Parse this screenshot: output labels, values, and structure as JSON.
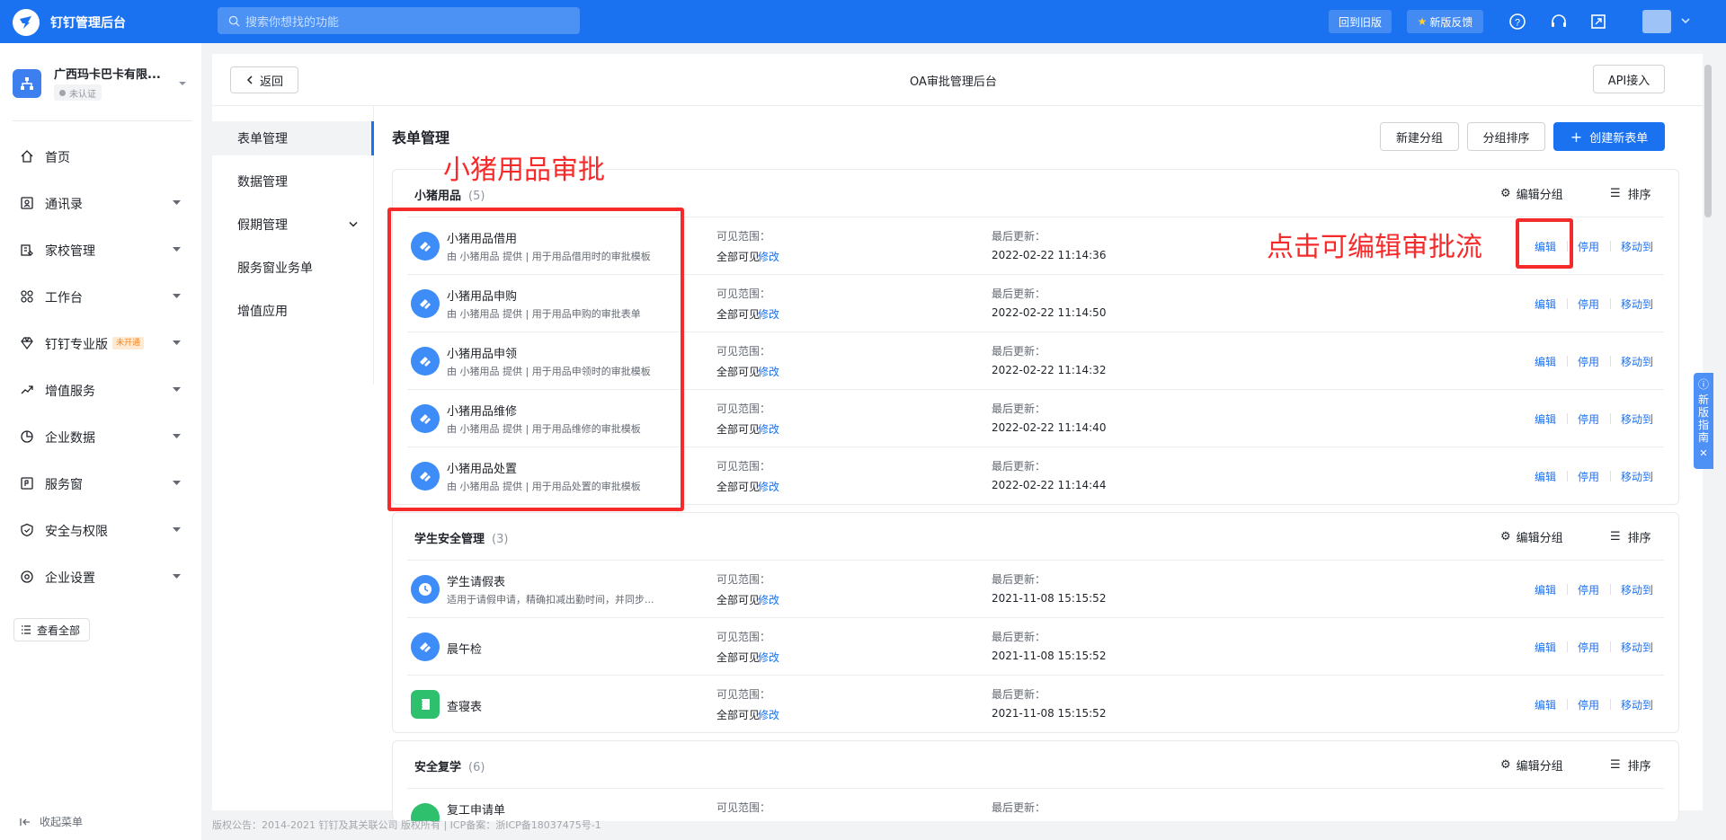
{
  "topbar": {
    "app_title": "钉钉管理后台",
    "search_placeholder": "搜索你想找的功能",
    "old_version_label": "回到旧版",
    "feedback_label": "新版反馈"
  },
  "sidebar": {
    "org_name": "广西玛卡巴卡有限...",
    "org_status": "未认证",
    "items": [
      {
        "label": "首页",
        "icon": "home-icon"
      },
      {
        "label": "通讯录",
        "icon": "contacts-icon"
      },
      {
        "label": "家校管理",
        "icon": "school-icon"
      },
      {
        "label": "工作台",
        "icon": "workbench-icon"
      },
      {
        "label": "钉钉专业版",
        "icon": "diamond-icon",
        "tag": "未开通"
      },
      {
        "label": "增值服务",
        "icon": "trend-icon"
      },
      {
        "label": "企业数据",
        "icon": "data-icon"
      },
      {
        "label": "服务窗",
        "icon": "service-window-icon"
      },
      {
        "label": "安全与权限",
        "icon": "shield-icon"
      },
      {
        "label": "企业设置",
        "icon": "settings-icon"
      }
    ],
    "view_all": "查看全部",
    "collapse": "收起菜单"
  },
  "main": {
    "back_label": "返回",
    "title": "OA审批管理后台",
    "api_label": "API接入",
    "subnav": [
      "表单管理",
      "数据管理",
      "假期管理",
      "服务窗业务单",
      "增值应用"
    ],
    "content_title": "表单管理",
    "new_group": "新建分组",
    "group_sort": "分组排序",
    "create_form": "创建新表单",
    "edit_group": "编辑分组",
    "sort": "排序",
    "visibility_label": "可见范围：",
    "visibility_value": "全部可见",
    "modify": "修改",
    "updated_label": "最后更新：",
    "actions": {
      "edit": "编辑",
      "disable": "停用",
      "move": "移动到"
    }
  },
  "groups": [
    {
      "name": "小猪用品",
      "count": "(5)",
      "rows": [
        {
          "name": "小猪用品借用",
          "desc": "由 小猪用品 提供 | 用于用品借用时的审批模板",
          "updated": "2022-02-22 11:14:36",
          "icon": "approval-icon",
          "color": "#3e8cf7"
        },
        {
          "name": "小猪用品申购",
          "desc": "由 小猪用品 提供 | 用于用品申购的审批表单",
          "updated": "2022-02-22 11:14:50",
          "icon": "approval-icon",
          "color": "#3e8cf7"
        },
        {
          "name": "小猪用品申领",
          "desc": "由 小猪用品 提供 | 用于用品申领时的审批模板",
          "updated": "2022-02-22 11:14:32",
          "icon": "approval-icon",
          "color": "#3e8cf7"
        },
        {
          "name": "小猪用品维修",
          "desc": "由 小猪用品 提供 | 用于用品维修的审批模板",
          "updated": "2022-02-22 11:14:40",
          "icon": "approval-icon",
          "color": "#3e8cf7"
        },
        {
          "name": "小猪用品处置",
          "desc": "由 小猪用品 提供 | 用于用品处置的审批模板",
          "updated": "2022-02-22 11:14:44",
          "icon": "approval-icon",
          "color": "#3e8cf7"
        }
      ]
    },
    {
      "name": "学生安全管理",
      "count": "(3)",
      "rows": [
        {
          "name": "学生请假表",
          "desc": "适用于请假申请，精确扣减出勤时间，并同步...",
          "updated": "2021-11-08 15:15:52",
          "icon": "clock-icon",
          "color": "#3e8cf7"
        },
        {
          "name": "晨午检",
          "desc": "",
          "updated": "2021-11-08 15:15:52",
          "icon": "approval-icon",
          "color": "#3e8cf7"
        },
        {
          "name": "查寝表",
          "desc": "",
          "updated": "2021-11-08 15:15:52",
          "icon": "notebook-icon",
          "color": "#2ec06d"
        }
      ]
    },
    {
      "name": "安全复学",
      "count": "(6)",
      "rows": [
        {
          "name": "复工申请单",
          "desc": "",
          "updated": "",
          "icon": "approval-icon",
          "color": "#2ec06d"
        }
      ]
    }
  ],
  "annotations": {
    "group_label": "小猪用品审批",
    "edit_hint": "点击可编辑审批流"
  },
  "footer": "版权公告：2014-2021 钉钉及其关联公司 版权所有 | ICP备案：浙ICP备18037475号-1",
  "guide": {
    "label": "新版指南"
  },
  "colors": {
    "brand": "#1a72f1",
    "annotation": "#f52a2a",
    "green": "#2ec06d"
  }
}
